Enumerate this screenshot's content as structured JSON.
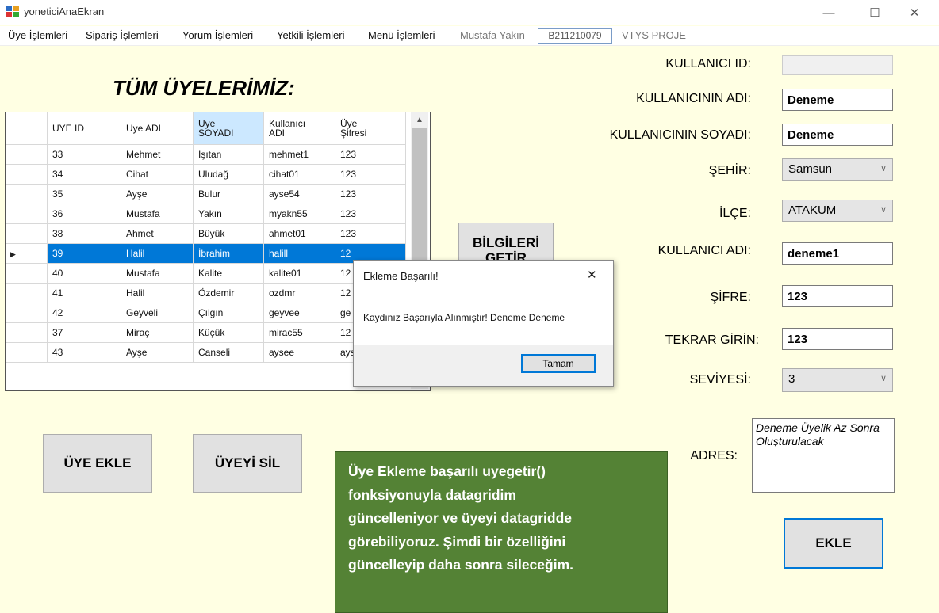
{
  "window": {
    "title": "yoneticiAnaEkran",
    "minimize_glyph": "—",
    "maximize_glyph": "☐",
    "close_glyph": "✕"
  },
  "menu": {
    "items": [
      "Üye İşlemleri",
      "Sipariş İşlemleri",
      "Yorum İşlemleri",
      "Yetkili İşlemleri",
      "Menü İşlemleri"
    ],
    "user_name": "Mustafa Yakın",
    "student_no": "B211210079",
    "project": "VTYS PROJE"
  },
  "heading": "TÜM ÜYELERİMİZ:",
  "grid": {
    "columns": [
      "UYE ID",
      "Uye ADI",
      "Uye SOYADI",
      "Kullanıcı ADI",
      "Üye Şifresi"
    ],
    "rows": [
      [
        "33",
        "Mehmet",
        "Işıtan",
        "mehmet1",
        "123"
      ],
      [
        "34",
        "Cihat",
        "Uludağ",
        "cihat01",
        "123"
      ],
      [
        "35",
        "Ayşe",
        "Bulur",
        "ayse54",
        "123"
      ],
      [
        "36",
        "Mustafa",
        "Yakın",
        "myakn55",
        "123"
      ],
      [
        "38",
        "Ahmet",
        "Büyük",
        "ahmet01",
        "123"
      ],
      [
        "39",
        "Halil",
        "İbrahim",
        "halill",
        "12"
      ],
      [
        "40",
        "Mustafa",
        "Kalite",
        "kalite01",
        "12"
      ],
      [
        "41",
        "Halil",
        "Özdemir",
        "ozdmr",
        "12"
      ],
      [
        "42",
        "Geyveli",
        "Çılgın",
        "geyvee",
        "ge"
      ],
      [
        "37",
        "Miraç",
        "Küçük",
        "mirac55",
        "12"
      ],
      [
        "43",
        "Ayşe",
        "Canseli",
        "aysee",
        "ays001"
      ]
    ],
    "selected_row": 5,
    "row_pointer": "▶"
  },
  "buttons": {
    "get_info": "BİLGİLERİ GETİR",
    "add_member": "ÜYE EKLE",
    "delete_member": "ÜYEYİ SİL",
    "add": "EKLE"
  },
  "form": {
    "user_id_label": "KULLANICI ID:",
    "user_id_value": "",
    "name_label": "KULLANICININ ADI:",
    "name_value": "Deneme",
    "surname_label": "KULLANICININ SOYADI:",
    "surname_value": "Deneme",
    "city_label": "ŞEHİR:",
    "city_value": "Samsun",
    "district_label": "İLÇE:",
    "district_value": "ATAKUM",
    "username_label": "KULLANICI ADI:",
    "username_value": "deneme1",
    "password_label": "ŞİFRE:",
    "password_value": "123",
    "repeat_label": "TEKRAR GİRİN:",
    "repeat_value": "123",
    "level_label": "SEVİYESİ:",
    "level_value": "3",
    "address_label": "ADRES:",
    "address_value": "Deneme Üyelik Az Sonra Oluşturulacak"
  },
  "dialog": {
    "title": "Ekleme Başarılı!",
    "message": "Kaydınız Başarıyla Alınmıştır! Deneme Deneme",
    "ok": "Tamam",
    "close_glyph": "✕"
  },
  "note": {
    "lines": [
      "Üye Ekleme başarılı uyegetir()",
      "fonksiyonuyla datagridim",
      "güncelleniyor ve üyeyi datagridde",
      "görebiliyoruz. Şimdi bir özelliğini",
      "güncelleyip daha sonra sileceğim."
    ]
  },
  "colors": {
    "background": "#ffffe3",
    "selection": "#0078d7",
    "note": "#548235"
  }
}
